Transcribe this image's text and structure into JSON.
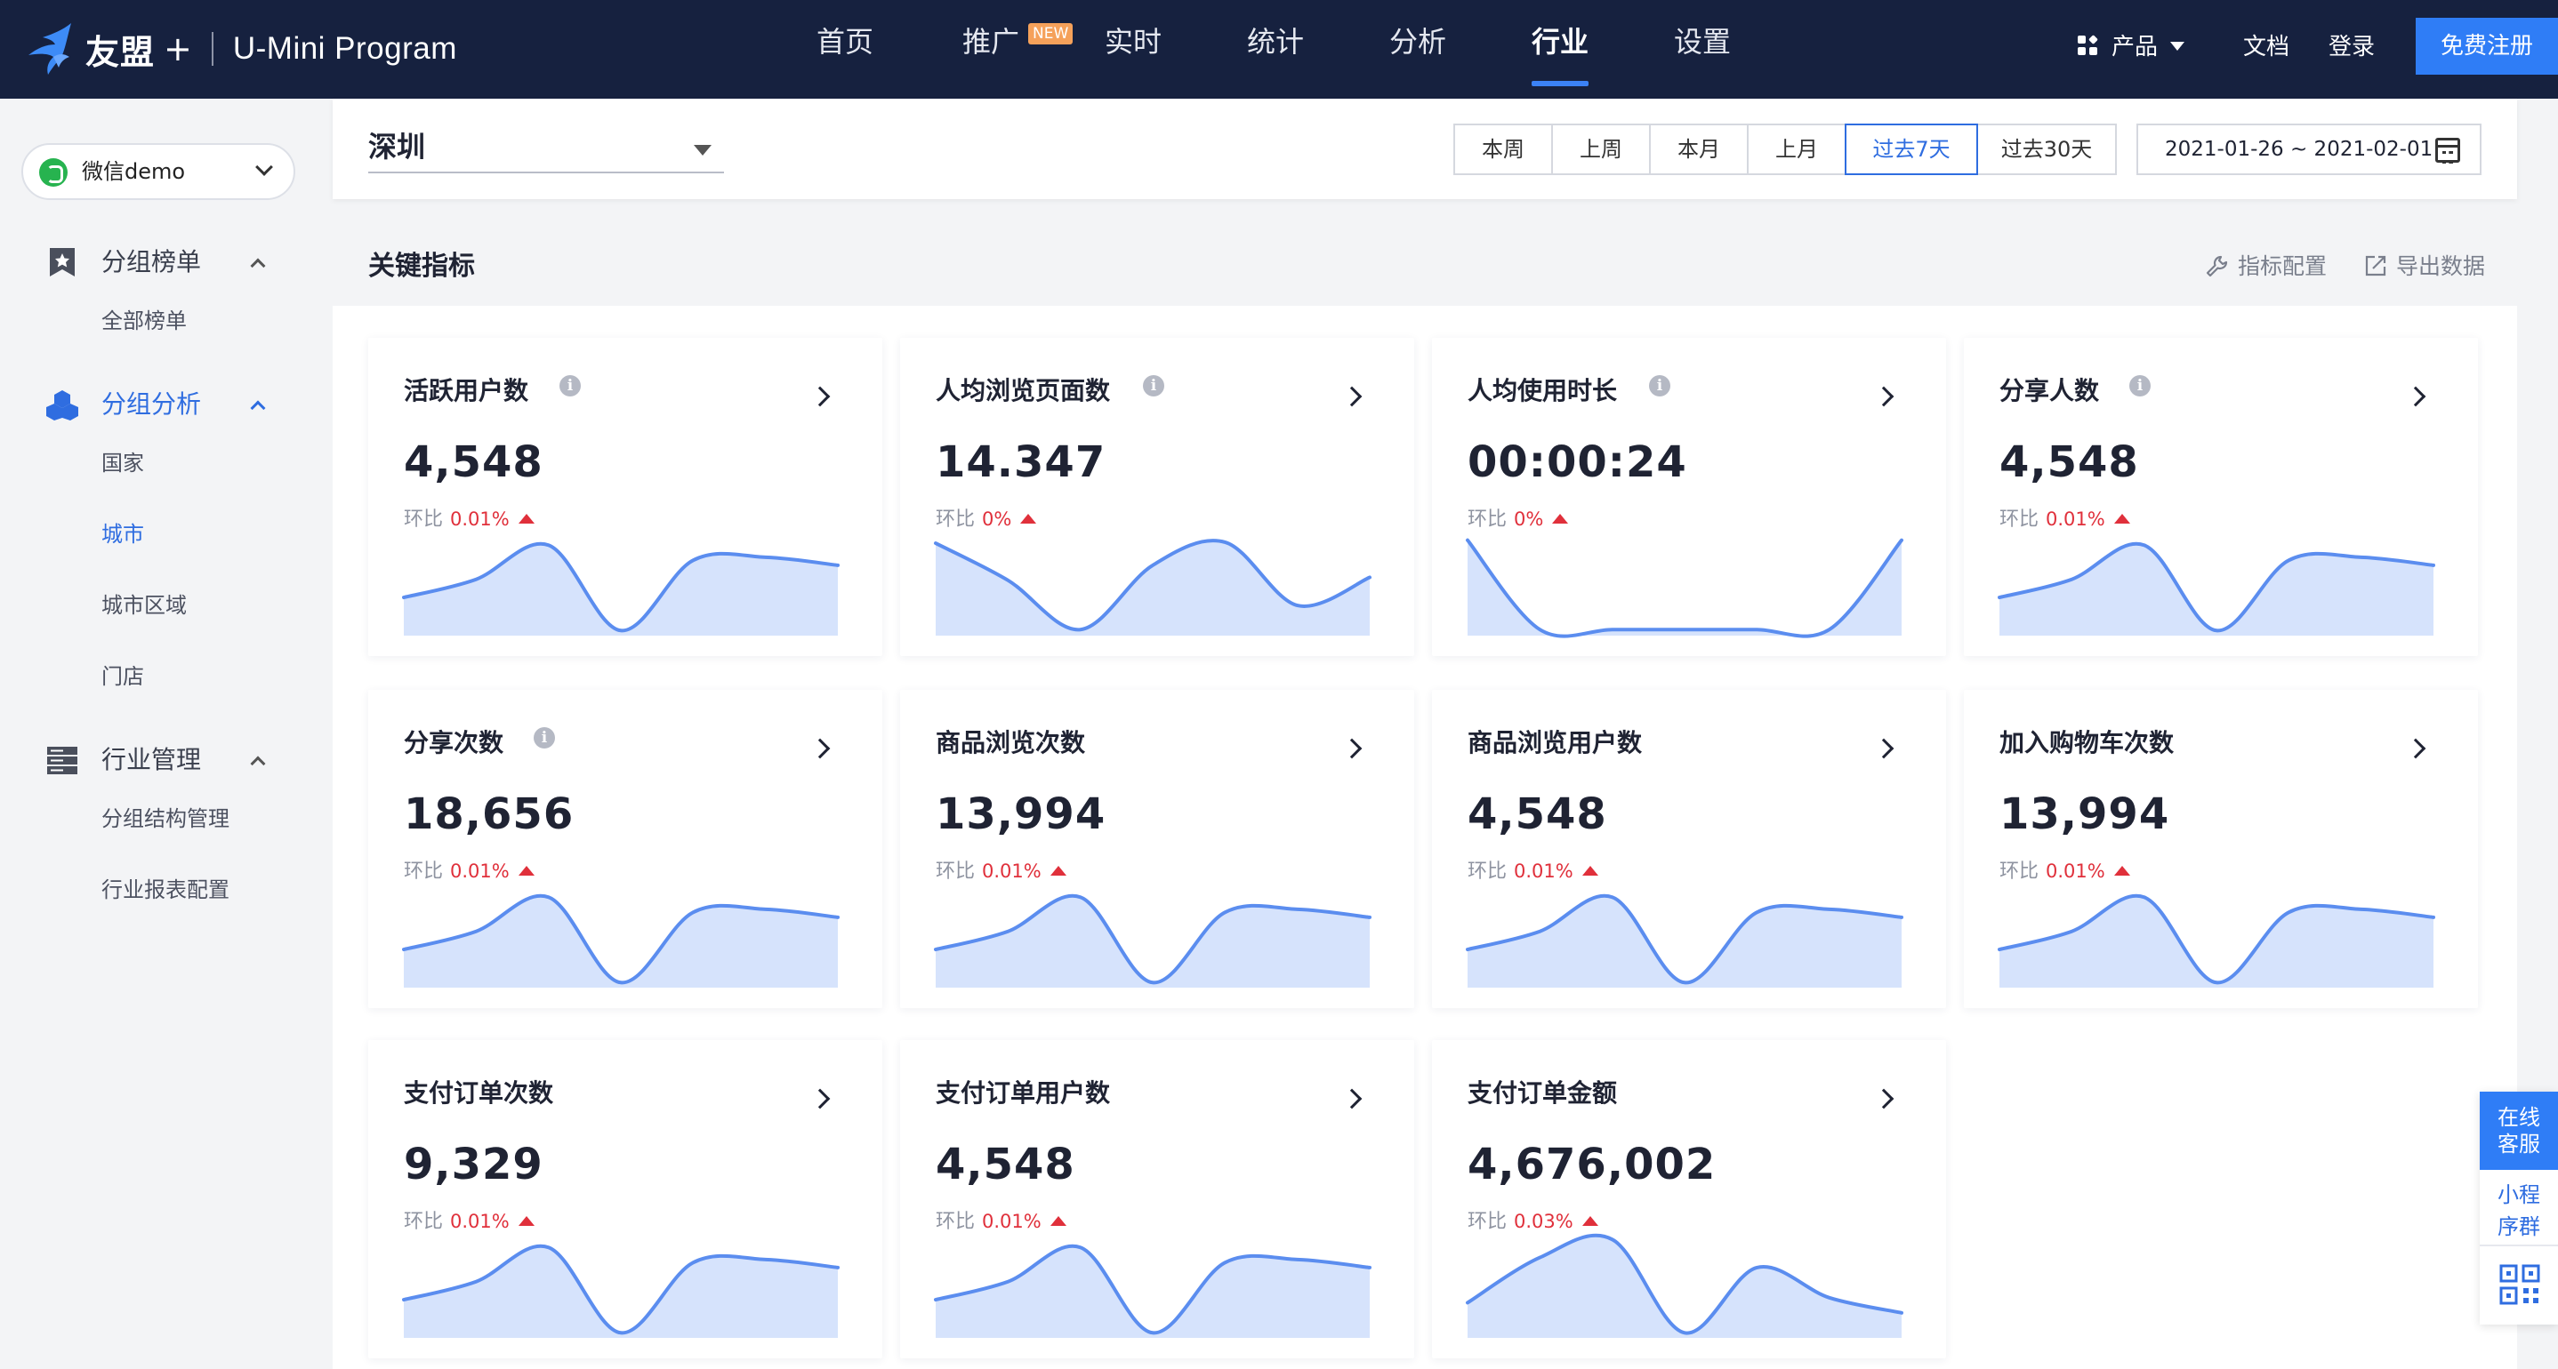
{
  "header": {
    "brand": "友盟",
    "plus": "+",
    "product": "U-Mini Program",
    "nav": [
      {
        "label": "首页",
        "active": false
      },
      {
        "label": "推广",
        "badge": "NEW",
        "active": false
      },
      {
        "label": "实时",
        "active": false
      },
      {
        "label": "统计",
        "active": false
      },
      {
        "label": "分析",
        "active": false
      },
      {
        "label": "行业",
        "active": true
      },
      {
        "label": "设置",
        "active": false
      }
    ],
    "right": {
      "products_label": "产品",
      "docs_label": "文档",
      "login_label": "登录",
      "register_label": "免费注册"
    }
  },
  "sidebar": {
    "app_name": "微信demo",
    "groups": [
      {
        "label": "分组榜单",
        "icon": "star-bookmark-icon",
        "active": false,
        "items": [
          {
            "label": "全部榜单",
            "active": false
          }
        ]
      },
      {
        "label": "分组分析",
        "icon": "cubes-icon",
        "active": true,
        "items": [
          {
            "label": "国家",
            "active": false
          },
          {
            "label": "城市",
            "active": true
          },
          {
            "label": "城市区域",
            "active": false
          },
          {
            "label": "门店",
            "active": false
          }
        ]
      },
      {
        "label": "行业管理",
        "icon": "server-stack-icon",
        "active": false,
        "items": [
          {
            "label": "分组结构管理",
            "active": false
          },
          {
            "label": "行业报表配置",
            "active": false
          }
        ]
      }
    ]
  },
  "filter": {
    "city": "深圳",
    "periods": [
      "本周",
      "上周",
      "本月",
      "上月",
      "过去7天",
      "过去30天"
    ],
    "active_period": "过去7天",
    "date_range": "2021-01-26 ~ 2021-02-01"
  },
  "panel": {
    "title": "关键指标",
    "config_label": "指标配置",
    "export_label": "导出数据"
  },
  "compare_label": "环比",
  "metrics": [
    {
      "title": "活跃用户数",
      "info": true,
      "value": "4,548",
      "change": "0.01%",
      "spark": [
        0.38,
        0.56,
        0.9,
        0.05,
        0.75,
        0.78,
        0.7
      ]
    },
    {
      "title": "人均浏览页面数",
      "info": true,
      "value": "14.347",
      "change": "0%",
      "spark": [
        0.92,
        0.55,
        0.06,
        0.7,
        0.93,
        0.3,
        0.58
      ]
    },
    {
      "title": "人均使用时长",
      "info": true,
      "value": "00:00:24",
      "change": "0%",
      "spark": [
        0.95,
        0.06,
        0.06,
        0.06,
        0.06,
        0.06,
        0.95
      ]
    },
    {
      "title": "分享人数",
      "info": true,
      "value": "4,548",
      "change": "0.01%",
      "spark": [
        0.38,
        0.56,
        0.9,
        0.05,
        0.75,
        0.78,
        0.7
      ]
    },
    {
      "title": "分享次数",
      "info": true,
      "value": "18,656",
      "change": "0.01%",
      "spark": [
        0.38,
        0.56,
        0.9,
        0.05,
        0.75,
        0.78,
        0.7
      ]
    },
    {
      "title": "商品浏览次数",
      "info": false,
      "value": "13,994",
      "change": "0.01%",
      "spark": [
        0.38,
        0.56,
        0.9,
        0.05,
        0.75,
        0.78,
        0.7
      ]
    },
    {
      "title": "商品浏览用户数",
      "info": false,
      "value": "4,548",
      "change": "0.01%",
      "spark": [
        0.38,
        0.56,
        0.9,
        0.05,
        0.75,
        0.78,
        0.7
      ]
    },
    {
      "title": "加入购物车次数",
      "info": false,
      "value": "13,994",
      "change": "0.01%",
      "spark": [
        0.38,
        0.56,
        0.9,
        0.05,
        0.75,
        0.78,
        0.7
      ]
    },
    {
      "title": "支付订单次数",
      "info": false,
      "value": "9,329",
      "change": "0.01%",
      "spark": [
        0.38,
        0.56,
        0.9,
        0.05,
        0.75,
        0.78,
        0.7
      ]
    },
    {
      "title": "支付订单用户数",
      "info": false,
      "value": "4,548",
      "change": "0.01%",
      "spark": [
        0.38,
        0.56,
        0.9,
        0.05,
        0.75,
        0.78,
        0.7
      ]
    },
    {
      "title": "支付订单金额",
      "info": false,
      "value": "4,676,002",
      "change": "0.03%",
      "spark": [
        0.35,
        0.8,
        0.98,
        0.05,
        0.7,
        0.4,
        0.25
      ]
    }
  ],
  "float_widget": {
    "service_label": "在线客服",
    "group_label": "小程序群"
  },
  "colors": {
    "nav_bg": "#16213f",
    "accent": "#2f7df6",
    "active_text": "#2f6de0",
    "increase": "#e0303b",
    "spark_line": "#5b8def",
    "spark_fill": "#d6e3fc"
  }
}
